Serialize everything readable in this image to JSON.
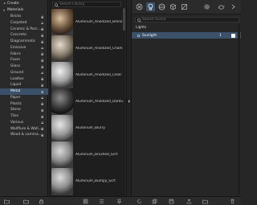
{
  "categories": {
    "create_label": "Create",
    "materials_label": "Materials",
    "items": [
      {
        "label": "Bricks"
      },
      {
        "label": "Carpeted"
      },
      {
        "label": "Ceramic & Porc..."
      },
      {
        "label": "Concrete"
      },
      {
        "label": "Diagrammatic"
      },
      {
        "label": "Emissive"
      },
      {
        "label": "Fabric"
      },
      {
        "label": "Foam"
      },
      {
        "label": "Glass"
      },
      {
        "label": "Ground"
      },
      {
        "label": "Leather"
      },
      {
        "label": "Liquid"
      },
      {
        "label": "Metal"
      },
      {
        "label": "Paper"
      },
      {
        "label": "Plastic"
      },
      {
        "label": "Stone"
      },
      {
        "label": "Tiles"
      },
      {
        "label": "Various"
      },
      {
        "label": "Wallflure & Wall..."
      },
      {
        "label": "Wood & Lamina..."
      }
    ],
    "selected": "Metal"
  },
  "library": {
    "search_placeholder": "Search Library",
    "materials": [
      {
        "name": "Aluminum_Anodized_Bronz"
      },
      {
        "name": "Aluminum_Anodized_Cham"
      },
      {
        "name": "Aluminum_Anodized_Clear"
      },
      {
        "name": "Aluminum_Anodized_DarkG"
      },
      {
        "name": "Aluminum_Blurry"
      },
      {
        "name": "Aluminum_Brushed_Scrt"
      },
      {
        "name": "Aluminum_Bumpy_Scrt"
      }
    ]
  },
  "scene": {
    "search_placeholder": "Search Scene",
    "section_label": "Lights",
    "lights": [
      {
        "name": "Sunlight",
        "count": "1",
        "color": "#ffffff"
      }
    ]
  },
  "colors": {
    "selection": "#3b5069",
    "panel": "#262626"
  }
}
